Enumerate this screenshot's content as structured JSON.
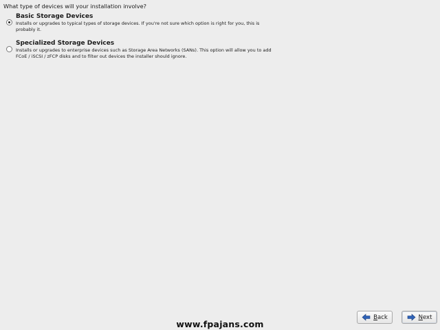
{
  "question": "What type of devices will your installation involve?",
  "options": [
    {
      "title": "Basic Storage Devices",
      "description": "Installs or upgrades to typical types of storage devices.  If you're not sure which option is right for you, this is probably it.",
      "selected": true
    },
    {
      "title": "Specialized Storage Devices",
      "description": "Installs or upgrades to enterprise devices such as Storage Area Networks (SANs). This option will allow you to add FCoE / iSCSI / zFCP disks and to filter out devices the installer should ignore.",
      "selected": false
    }
  ],
  "watermark": "www.fpajans.com",
  "buttons": {
    "back": {
      "mnemonic": "B",
      "rest": "ack",
      "icon": "back-arrow-icon"
    },
    "next": {
      "mnemonic": "N",
      "rest": "ext",
      "icon": "next-arrow-icon"
    }
  },
  "colors": {
    "background": "#ededed",
    "arrow": "#2f63b8"
  }
}
